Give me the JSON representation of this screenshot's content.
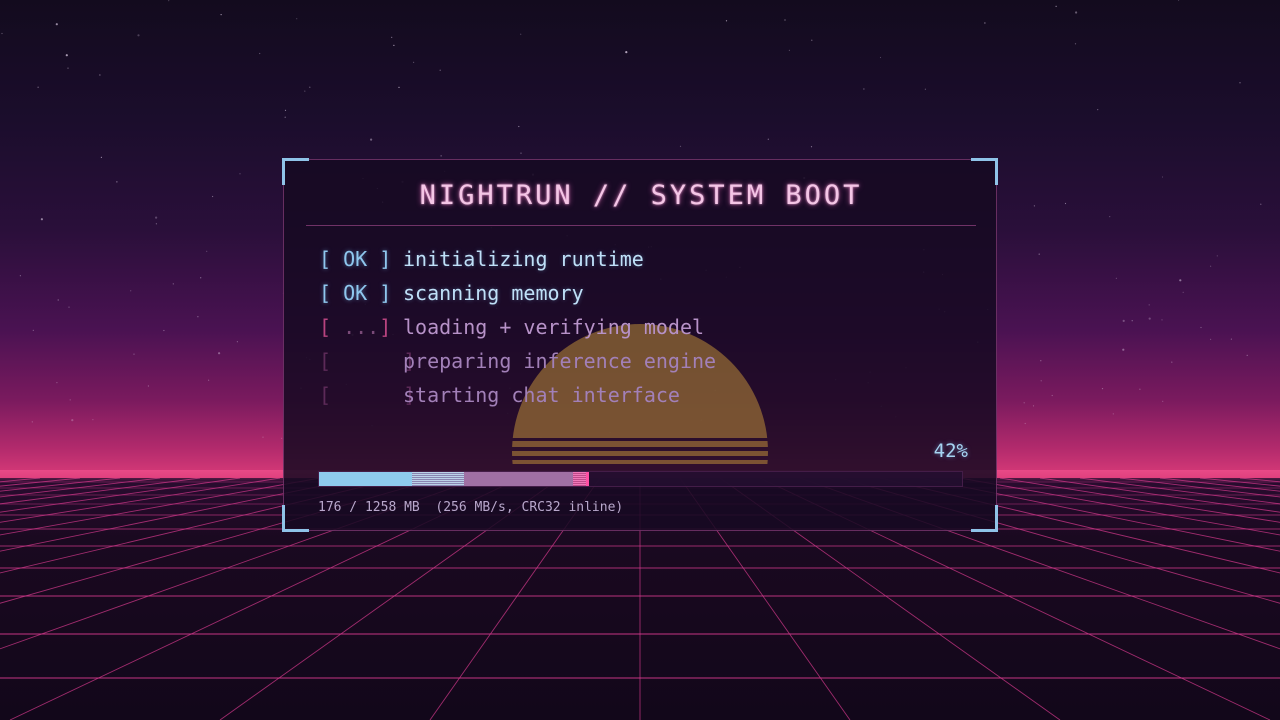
{
  "colors": {
    "accent_cyan": "#8fc7ee",
    "accent_pink": "#ff4fa4",
    "title": "#f4c6e6",
    "sun": "#c9973a",
    "grid": "#d93a8f"
  },
  "panel": {
    "title": "NIGHTRUN // SYSTEM BOOT",
    "steps": [
      {
        "status": "ok",
        "bracket": "[ OK ]",
        "label": "initializing runtime"
      },
      {
        "status": "ok",
        "bracket": "[ OK ]",
        "label": "scanning memory"
      },
      {
        "status": "active",
        "bracket_open": "[",
        "bracket_dots": " ...",
        "bracket_close": "]",
        "label": "loading + verifying model"
      },
      {
        "status": "pending",
        "bracket": "[      ]",
        "label": "preparing inference engine"
      },
      {
        "status": "pending",
        "bracket": "[      ]",
        "label": "starting chat interface"
      }
    ],
    "progress": {
      "percent_label": "42%",
      "fraction": 0.42,
      "verified_fraction": 0.225
    },
    "status_line": "176 / 1258 MB  (256 MB/s, CRC32 inline)"
  }
}
